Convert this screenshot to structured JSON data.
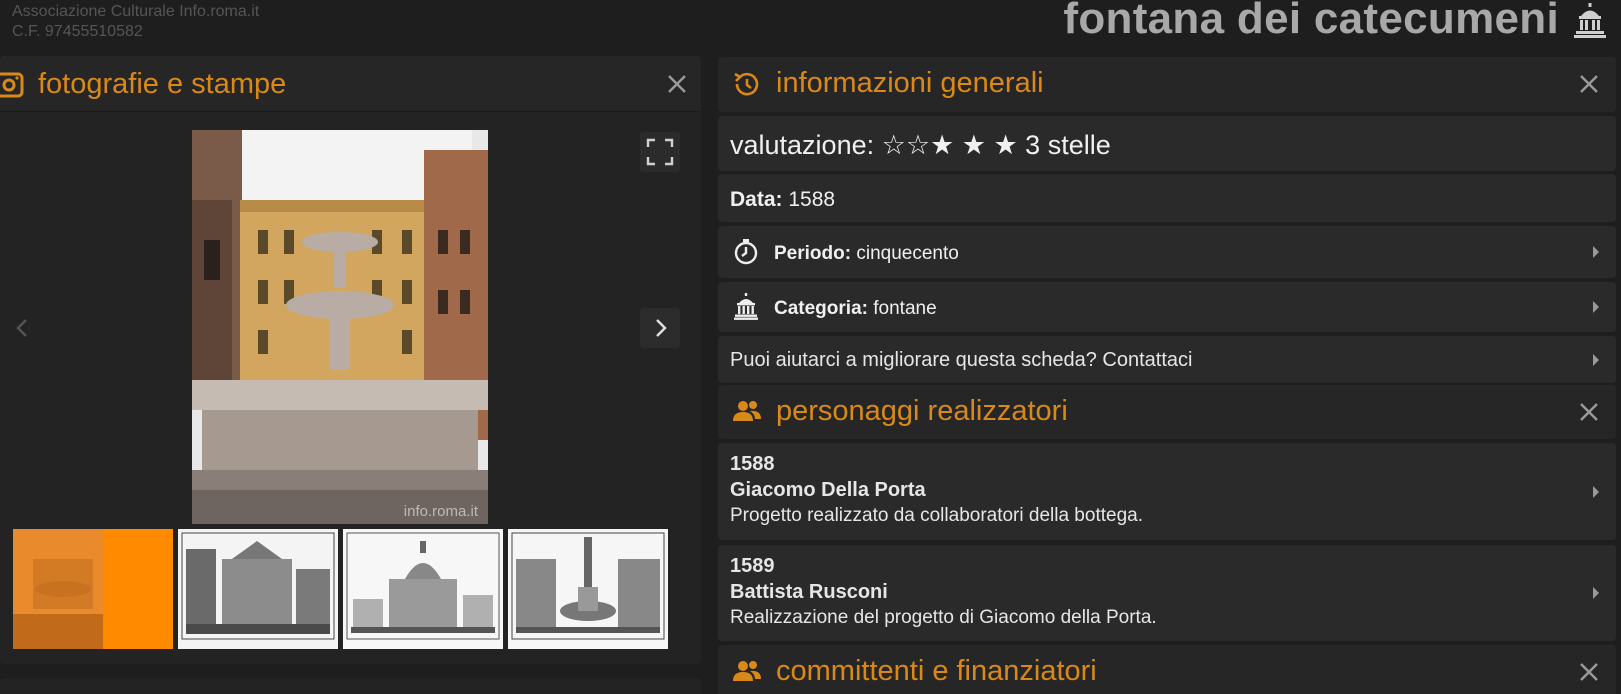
{
  "header": {
    "org_name": "Associazione Culturale Info.roma.it",
    "tax_code": "C.F. 97455510582",
    "title": "fontana dei catecumeni",
    "title_icon": "monument-icon"
  },
  "photos_panel": {
    "title": "fotografie e stampe",
    "icon": "camera-icon",
    "watermark": "info.roma.it",
    "thumbnails": [
      "thumbnail-1",
      "thumbnail-2",
      "thumbnail-3",
      "thumbnail-4"
    ]
  },
  "info_panel": {
    "title": "informazioni generali",
    "icon": "history-icon",
    "rating_label": "valutazione:",
    "rating_stars": "☆☆★ ★ ★",
    "rating_text": "3 stelle",
    "date_label": "Data:",
    "date_value": "1588",
    "period_label": "Periodo:",
    "period_value": "cinquecento",
    "category_label": "Categoria:",
    "category_value": "fontane",
    "help_text": "Puoi aiutarci a migliorare questa scheda? Contattaci"
  },
  "makers_section": {
    "title": "personaggi realizzatori",
    "icon": "people-icon",
    "people": [
      {
        "year": "1588",
        "name": "Giacomo Della Porta",
        "desc": "Progetto realizzato da collaboratori della bottega."
      },
      {
        "year": "1589",
        "name": "Battista Rusconi",
        "desc": "Realizzazione del progetto di Giacomo della Porta."
      }
    ]
  },
  "sponsors_section": {
    "title": "committenti e finanziatori",
    "icon": "people-icon"
  },
  "colors": {
    "accent": "#d8891a",
    "active_thumb": "#ff8a00"
  }
}
